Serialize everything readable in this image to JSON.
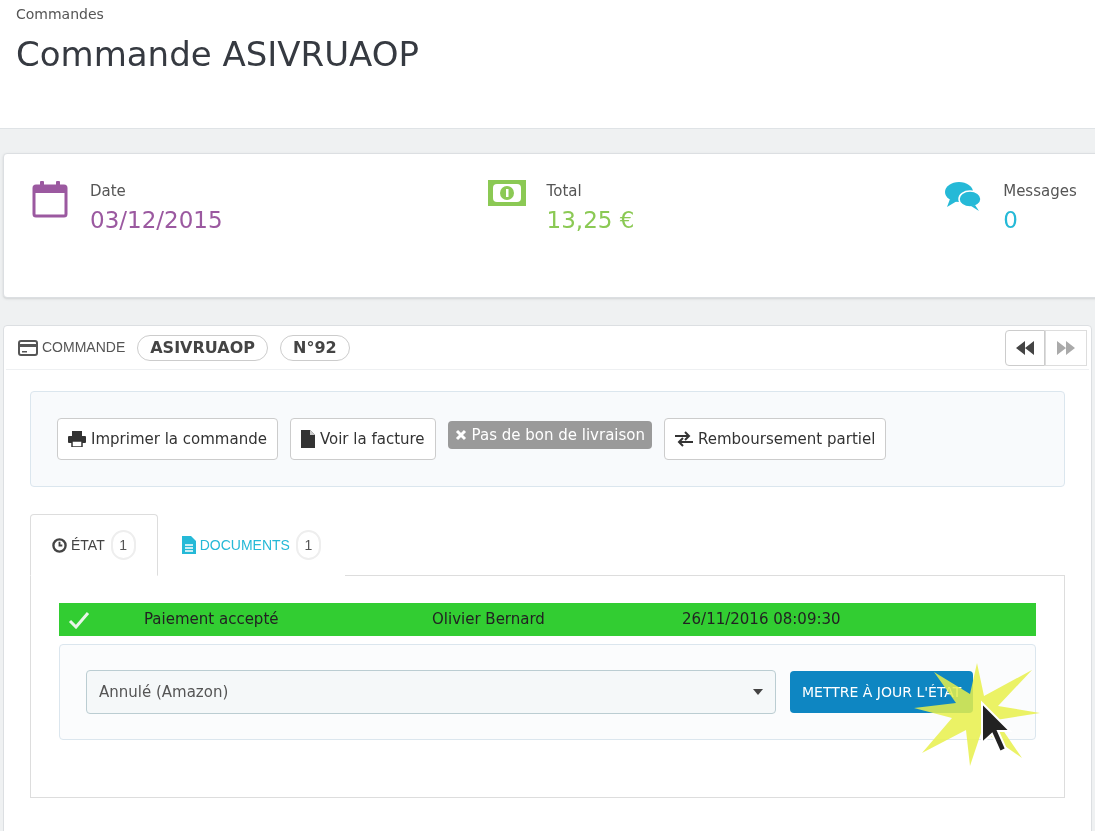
{
  "header": {
    "breadcrumb": "Commandes",
    "title": "Commande ASIVRUAOP"
  },
  "kpis": [
    {
      "kind": "calendar",
      "label": "Date",
      "value": "03/12/2015",
      "color": "#9b59a0"
    },
    {
      "kind": "money",
      "label": "Total",
      "value": "13,25 €",
      "color": "#8bc954"
    },
    {
      "kind": "messages",
      "label": "Messages",
      "value": "0",
      "color": "#25b9d7"
    }
  ],
  "order_panel": {
    "heading": "COMMANDE",
    "reference": "ASIVRUAOP",
    "number": "N°92",
    "actions": [
      {
        "kind": "print",
        "label": "Imprimer la commande",
        "disabled": false
      },
      {
        "kind": "file",
        "label": "Voir la facture",
        "disabled": false
      },
      {
        "kind": "cross",
        "label": "Pas de bon de livraison",
        "disabled": true
      },
      {
        "kind": "exchange",
        "label": "Remboursement partiel",
        "disabled": false
      }
    ],
    "tabs": [
      {
        "kind": "clock",
        "label": "ÉTAT",
        "count": "1",
        "selected": true
      },
      {
        "kind": "doc",
        "label": "DOCUMENTS",
        "count": "1",
        "selected": false
      }
    ],
    "history": [
      {
        "status": "Paiement accepté",
        "employee": "Olivier Bernard",
        "date": "26/11/2016 08:09:30",
        "color": "#32cd32"
      }
    ],
    "state_select": {
      "value": "Annulé (Amazon)"
    },
    "update_button": "METTRE À JOUR L'ÉTAT"
  }
}
